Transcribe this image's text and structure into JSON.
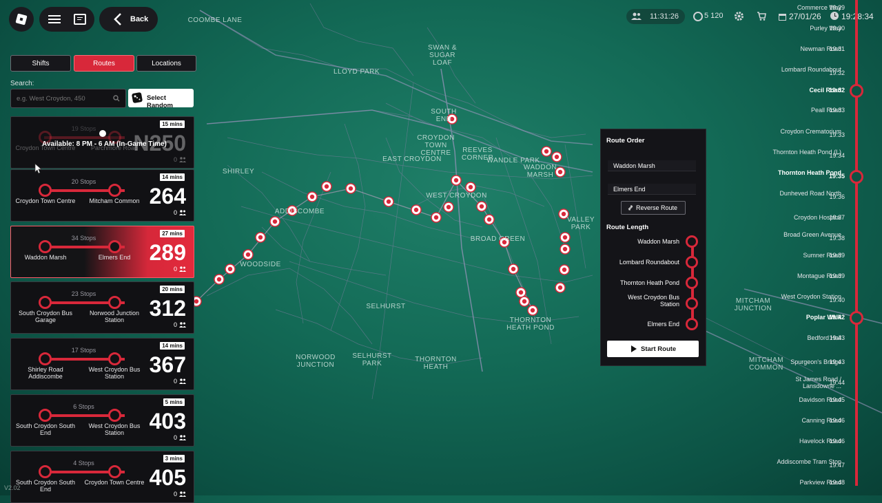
{
  "header": {
    "back_label": "Back",
    "players_time": "11:31:26",
    "coins": "5 120",
    "date": "27/01/26",
    "clock": "19:28:34"
  },
  "tabs": [
    {
      "label": "Shifts"
    },
    {
      "label": "Routes"
    },
    {
      "label": "Locations"
    }
  ],
  "search": {
    "label": "Search:",
    "placeholder": "e.g. West Croydon, 450",
    "random_label": "Select Random"
  },
  "cards": [
    {
      "stops": "19 Stops",
      "from": "Croydon Town Centre",
      "to": "Parchmore Road",
      "mins": "15 mins",
      "num": "N250",
      "players": "0",
      "overlay": "Available: 8 PM - 6 AM (In-Game Time)"
    },
    {
      "stops": "20 Stops",
      "from": "Croydon Town Centre",
      "to": "Mitcham Common",
      "mins": "14 mins",
      "num": "264",
      "players": "0"
    },
    {
      "stops": "34 Stops",
      "from": "Waddon Marsh",
      "to": "Elmers End",
      "mins": "27 mins",
      "num": "289",
      "players": "0"
    },
    {
      "stops": "23 Stops",
      "from": "South Croydon Bus Garage",
      "to": "Norwood Junction Station",
      "mins": "20 mins",
      "num": "312",
      "players": "0"
    },
    {
      "stops": "17 Stops",
      "from": "Shirley Road Addiscombe",
      "to": "West Croydon Bus Station",
      "mins": "14 mins",
      "num": "367",
      "players": "0"
    },
    {
      "stops": "6 Stops",
      "from": "South Croydon South End",
      "to": "West Croydon Bus Station",
      "mins": "5 mins",
      "num": "403",
      "players": "0"
    },
    {
      "stops": "4 Stops",
      "from": "South Croydon South End",
      "to": "Croydon Town Centre",
      "mins": "3 mins",
      "num": "405",
      "players": "0"
    }
  ],
  "version": "V2.02",
  "map": {
    "places": [
      {
        "name": "COOMBE LANE"
      },
      {
        "name": "SWAN & SUGAR LOAF"
      },
      {
        "name": "LLOYD PARK"
      },
      {
        "name": "SOUTH END"
      },
      {
        "name": "CROYDON TOWN CENTRE"
      },
      {
        "name": "REEVES CORNER"
      },
      {
        "name": "EAST CROYDON"
      },
      {
        "name": "WANDLE PARK"
      },
      {
        "name": "WADDON MARSH"
      },
      {
        "name": "SHIRLEY"
      },
      {
        "name": "ADDISCOMBE"
      },
      {
        "name": "WEST CROYDON"
      },
      {
        "name": "VALLEY PARK"
      },
      {
        "name": "BROAD GREEN"
      },
      {
        "name": "WOODSIDE"
      },
      {
        "name": "SELHURST"
      },
      {
        "name": "THORNTON HEATH POND"
      },
      {
        "name": "MITCHAM JUNCTION"
      },
      {
        "name": "NORWOOD JUNCTION"
      },
      {
        "name": "SELHURST PARK"
      },
      {
        "name": "THORNTON HEATH"
      },
      {
        "name": "MITCHAM COMMON"
      }
    ]
  },
  "popup": {
    "order_title": "Route Order",
    "start_field": "Waddon Marsh",
    "end_field": "Elmers End",
    "reverse_label": "Reverse Route",
    "length_title": "Route Length",
    "length_stops": [
      "Waddon Marsh",
      "Lombard Roundabout",
      "Thornton Heath Pond",
      "West Croydon Bus Station",
      "Elmers End"
    ],
    "start_label": "Start Route"
  },
  "timeline": [
    {
      "name": "Commerce Way",
      "time": "19:29",
      "major": false
    },
    {
      "name": "Purley Way",
      "time": "19:30",
      "major": false
    },
    {
      "name": "Newman Road",
      "time": "19:31",
      "major": false
    },
    {
      "name": "Lombard Roundabout",
      "time": "19:32",
      "major": false
    },
    {
      "name": "Cecil Road",
      "time": "19:32",
      "major": true
    },
    {
      "name": "Peall Road",
      "time": "19:33",
      "major": false
    },
    {
      "name": "Croydon Crematorium",
      "time": "19:33",
      "major": false
    },
    {
      "name": "Thornton Heath Pond (L)",
      "time": "19:34",
      "major": false
    },
    {
      "name": "Thornton Heath Pond",
      "time": "19:35",
      "major": true
    },
    {
      "name": "Dunheved Road North",
      "time": "19:36",
      "major": false
    },
    {
      "name": "Croydon Hospital",
      "time": "19:37",
      "major": false
    },
    {
      "name": "Broad Green Avenue",
      "time": "19:38",
      "major": false
    },
    {
      "name": "Sumner Road",
      "time": "19:39",
      "major": false
    },
    {
      "name": "Montague Road",
      "time": "19:39",
      "major": false
    },
    {
      "name": "West Croydon Station",
      "time": "19:40",
      "major": false
    },
    {
      "name": "Poplar Walk",
      "time": "19:42",
      "major": true
    },
    {
      "name": "Bedford Hall",
      "time": "19:43",
      "major": false
    },
    {
      "name": "Spurgeon's Bridge",
      "time": "19:43",
      "major": false
    },
    {
      "name": "St James Road / Lansdowne ...",
      "time": "19:44",
      "major": false
    },
    {
      "name": "Davidson Road",
      "time": "19:45",
      "major": false
    },
    {
      "name": "Canning Road",
      "time": "19:46",
      "major": false
    },
    {
      "name": "Havelock Road",
      "time": "19:46",
      "major": false
    },
    {
      "name": "Addiscombe Tram Stop",
      "time": "19:47",
      "major": false
    },
    {
      "name": "Parkview Road",
      "time": "19:48",
      "major": false
    }
  ],
  "colors": {
    "accent": "#d8283a",
    "panel": "#111114",
    "map": "#136a56"
  }
}
